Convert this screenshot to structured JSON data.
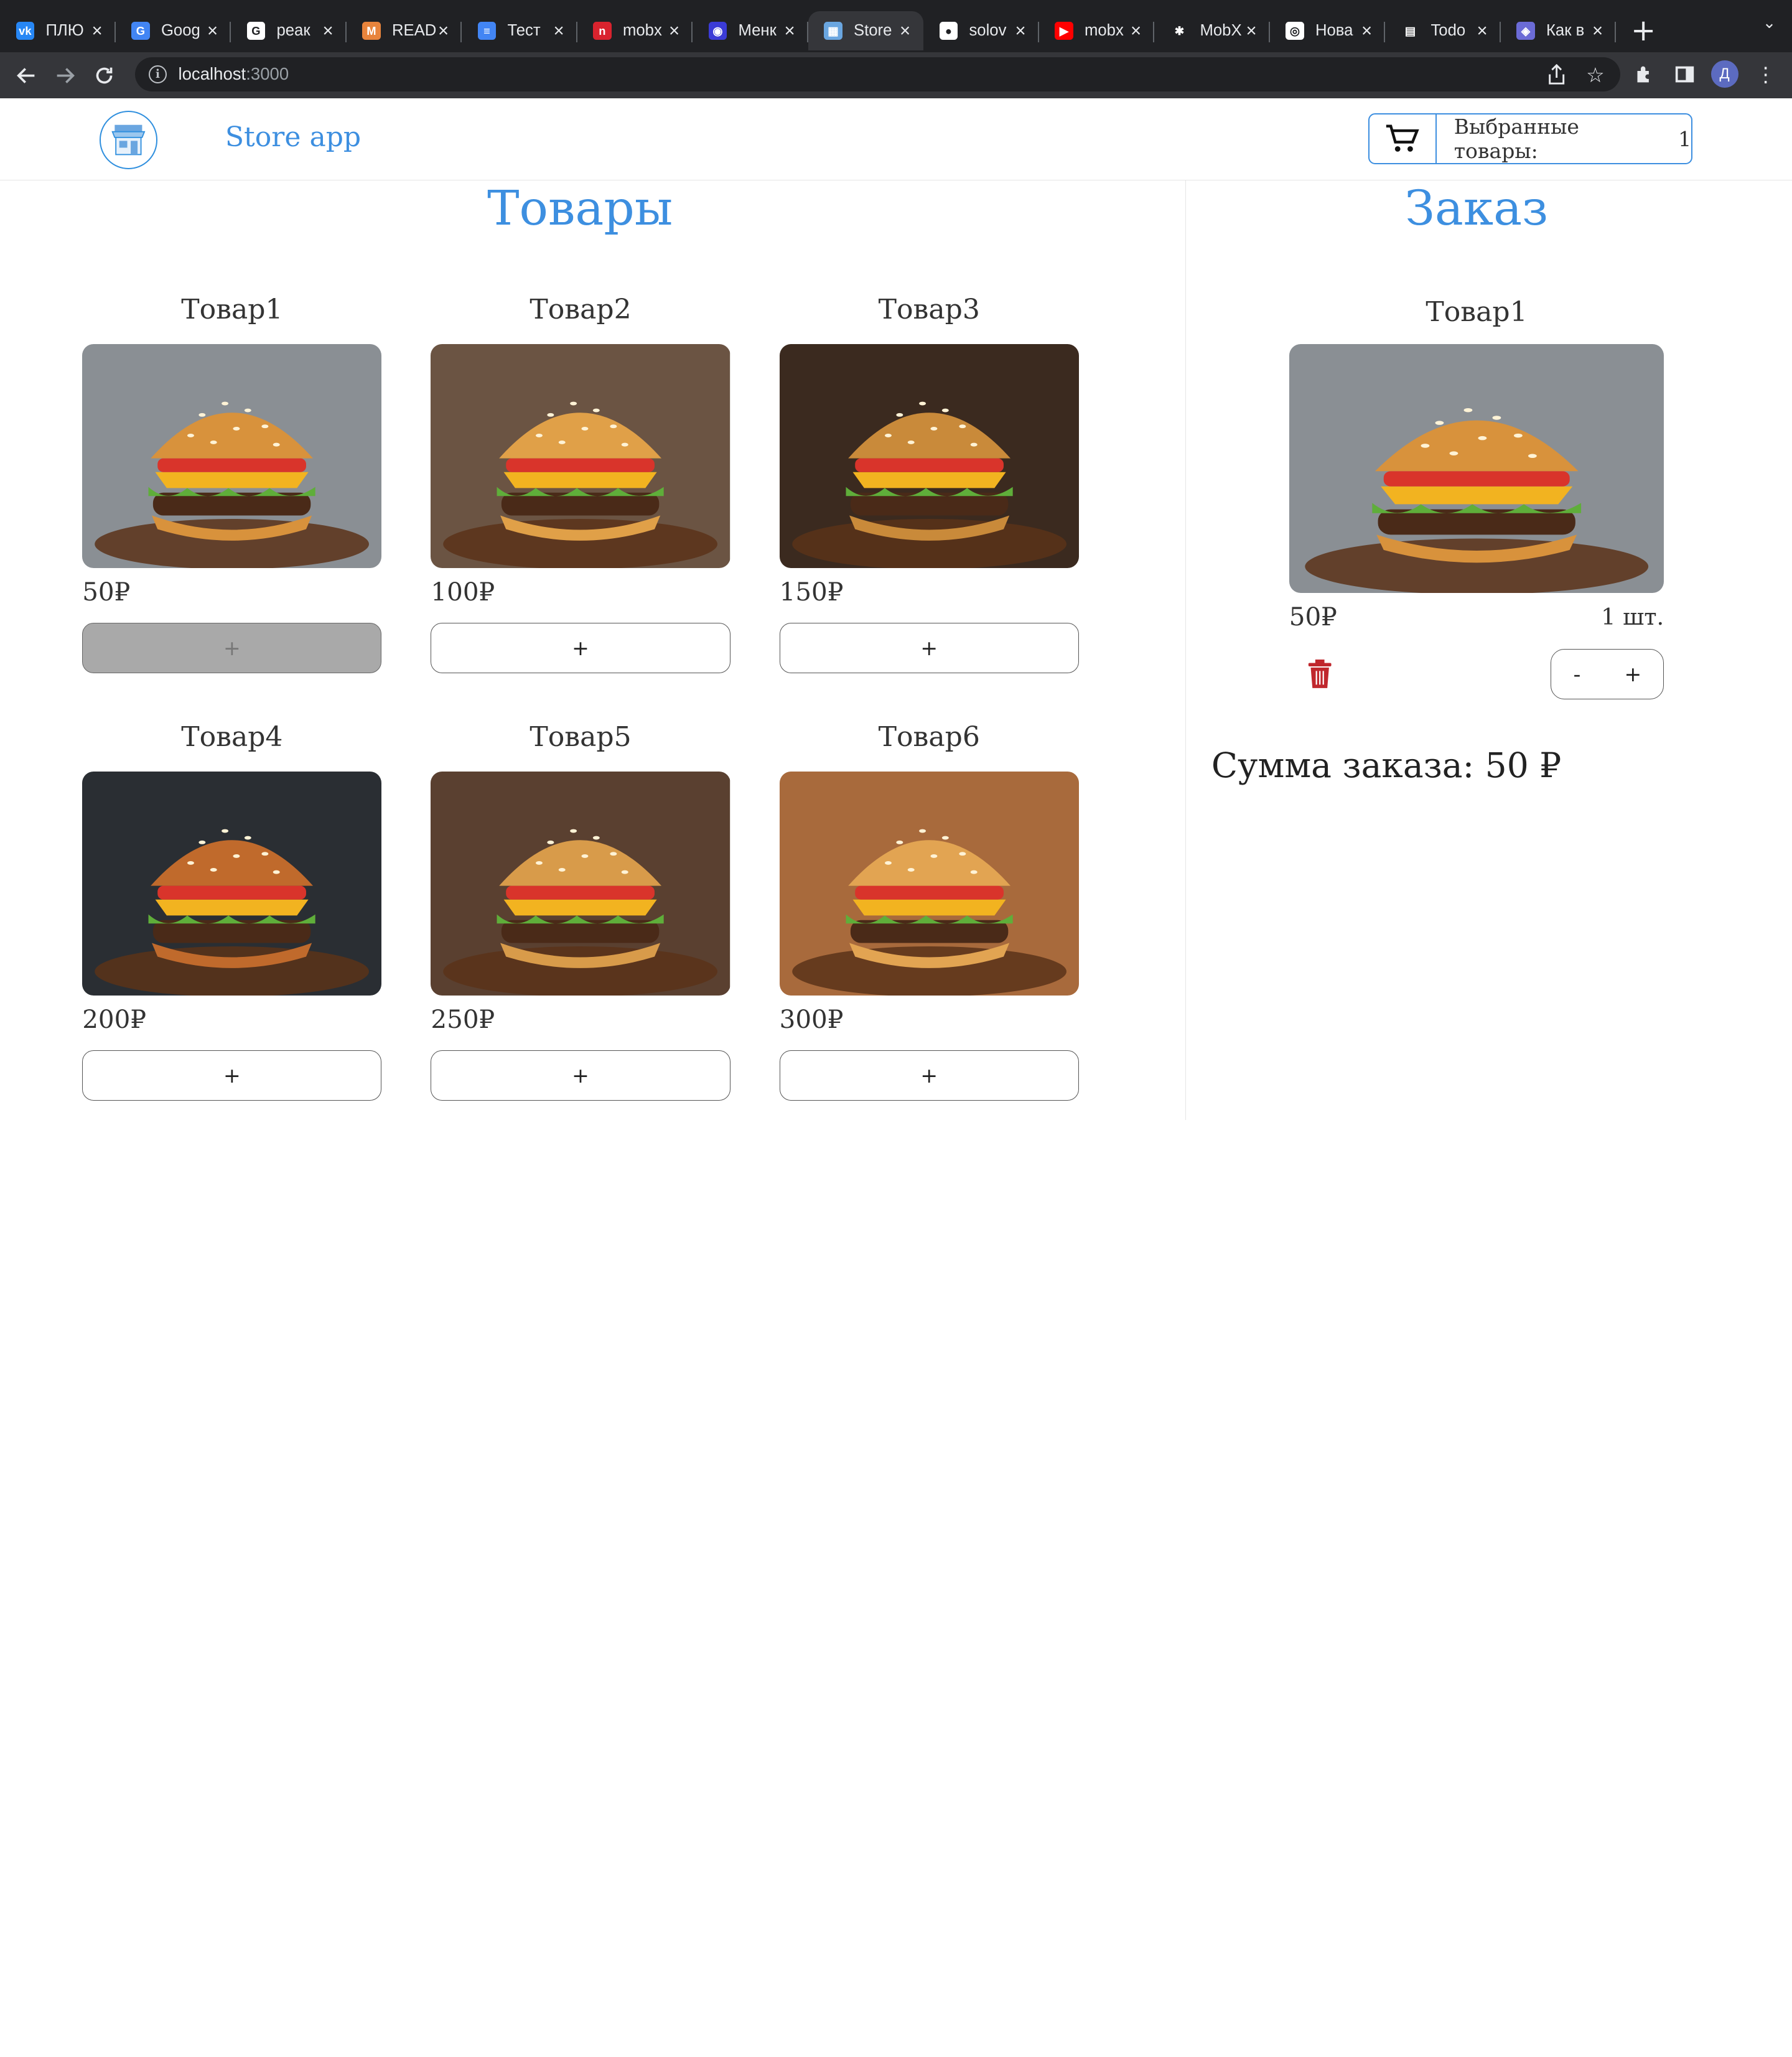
{
  "browser": {
    "tabs": [
      {
        "title": "ПЛЮ",
        "icon": "vk-icon",
        "color": "#2787f5",
        "glyph": "vk"
      },
      {
        "title": "Goog",
        "icon": "google-translate-icon",
        "color": "#4285f4",
        "glyph": "G"
      },
      {
        "title": "реак",
        "icon": "google-icon",
        "color": "#ffffff",
        "glyph": "G"
      },
      {
        "title": "READ",
        "icon": "readme-icon",
        "color": "#e8843c",
        "glyph": "M"
      },
      {
        "title": "Тест",
        "icon": "docs-icon",
        "color": "#4285f4",
        "glyph": "≡"
      },
      {
        "title": "mobx",
        "icon": "n-icon",
        "color": "#d9232e",
        "glyph": "n"
      },
      {
        "title": "Менк",
        "icon": "app-icon",
        "color": "#3b3bd6",
        "glyph": "◉"
      },
      {
        "title": "Store",
        "icon": "store-icon",
        "color": "#6aa6e0",
        "glyph": "▦",
        "active": true
      },
      {
        "title": "solov",
        "icon": "github-icon",
        "color": "#ffffff",
        "glyph": "●"
      },
      {
        "title": "mobx",
        "icon": "youtube-icon",
        "color": "#ff0000",
        "glyph": "▶"
      },
      {
        "title": "MobX",
        "icon": "bug-icon",
        "color": "#202124",
        "glyph": "✱"
      },
      {
        "title": "Нова",
        "icon": "chrome-icon",
        "color": "#ffffff",
        "glyph": "◎"
      },
      {
        "title": "Todo",
        "icon": "document-icon",
        "color": "#202124",
        "glyph": "▤"
      },
      {
        "title": "Как в",
        "icon": "app2-icon",
        "color": "#6b6bd6",
        "glyph": "◈"
      }
    ],
    "url_host": "localhost",
    "url_port": ":3000",
    "profile_initial": "Д"
  },
  "header": {
    "brand": "Store app",
    "cart_label": "Выбранные товары:",
    "cart_count": "1"
  },
  "products": {
    "title": "Товары",
    "items": [
      {
        "name": "Товар1",
        "price": "50₽",
        "button": "+",
        "disabled": true,
        "bg": "#8a8f94",
        "bun": "#d8923c"
      },
      {
        "name": "Товар2",
        "price": "100₽",
        "button": "+",
        "disabled": false,
        "bg": "#6b5443",
        "bun": "#e0a048"
      },
      {
        "name": "Товар3",
        "price": "150₽",
        "button": "+",
        "disabled": false,
        "bg": "#3b2a1f",
        "bun": "#c98a3a"
      },
      {
        "name": "Товар4",
        "price": "200₽",
        "button": "+",
        "disabled": false,
        "bg": "#2a2e33",
        "bun": "#c06a2c"
      },
      {
        "name": "Товар5",
        "price": "250₽",
        "button": "+",
        "disabled": false,
        "bg": "#5a4030",
        "bun": "#d89b4a"
      },
      {
        "name": "Товар6",
        "price": "300₽",
        "button": "+",
        "disabled": false,
        "bg": "#a86a3c",
        "bun": "#e2a452"
      }
    ]
  },
  "order": {
    "title": "Заказ",
    "item": {
      "name": "Товар1",
      "price": "50₽",
      "qty": "1 шт.",
      "minus": "-",
      "plus": "+"
    },
    "total": "Сумма заказа: 50 ₽"
  },
  "colors": {
    "accent": "#3d8fe0",
    "trash": "#c0272d"
  }
}
